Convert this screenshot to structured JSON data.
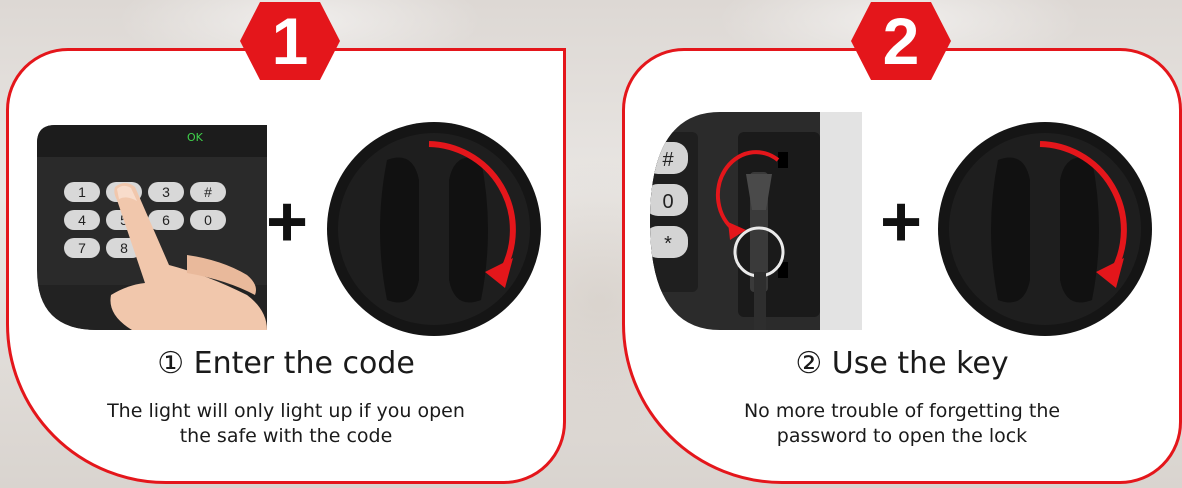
{
  "steps": [
    {
      "number": "1",
      "heading": "① Enter the code",
      "description_line1": "The light will only light up if you open",
      "description_line2": "the safe with the code"
    },
    {
      "number": "2",
      "heading": "② Use the key",
      "description_line1": "No more trouble of forgetting the",
      "description_line2": "password to open the lock"
    }
  ],
  "plus_symbol": "+",
  "keypad": {
    "display_text": "OK",
    "keys": [
      "1",
      "2",
      "3",
      "#",
      "4",
      "5",
      "6",
      "0",
      "7",
      "8"
    ]
  },
  "key_closeup_keys": [
    "#",
    "0",
    "*"
  ],
  "colors": {
    "accent": "#e4161b",
    "text": "#1a1a1a",
    "panel_bg": "#ffffff",
    "knob": "#151515",
    "display_green": "#3fd04a"
  },
  "icons": {
    "keypad_illustration": "finger-pressing-keypad-icon",
    "knob": "rotary-knob-icon",
    "key": "key-in-lock-icon"
  }
}
